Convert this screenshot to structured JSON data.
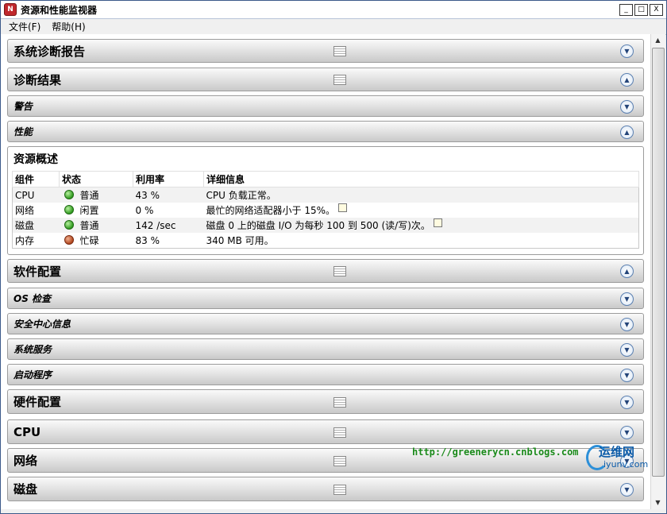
{
  "window": {
    "title": "资源和性能监视器",
    "app_icon": "N",
    "buttons": [
      "_",
      "□",
      "X"
    ]
  },
  "menu": [
    "文件(F)",
    "帮助(H)"
  ],
  "sections": {
    "sysreport": "系统诊断报告",
    "diag": "诊断结果",
    "warning": "警告",
    "perf": "性能",
    "software": "软件配置",
    "os": "OS 检查",
    "security": "安全中心信息",
    "services": "系统服务",
    "startup": "启动程序",
    "hardware": "硬件配置",
    "cpu": "CPU",
    "network": "网络",
    "disk": "磁盘"
  },
  "overview": {
    "title": "资源概述",
    "columns": [
      "组件",
      "状态",
      "利用率",
      "详细信息"
    ],
    "rows": [
      {
        "component": "CPU",
        "status": "普通",
        "status_color": "green",
        "usage": "43 %",
        "detail": "CPU 负载正常。"
      },
      {
        "component": "网络",
        "status": "闲置",
        "status_color": "green",
        "usage": "0 %",
        "detail": "最忙的网络适配器小于 15%。"
      },
      {
        "component": "磁盘",
        "status": "普通",
        "status_color": "green",
        "usage": "142 /sec",
        "detail": "磁盘 0 上的磁盘 I/O 为每秒 100 到 500 (读/写)次。"
      },
      {
        "component": "内存",
        "status": "忙碌",
        "status_color": "red",
        "usage": "83 %",
        "detail": "340 MB 可用。"
      }
    ]
  },
  "watermark": {
    "url": "http://greenerycn.cnblogs.com",
    "brand_cn": "运维网",
    "brand_url": "iyunv.com"
  }
}
